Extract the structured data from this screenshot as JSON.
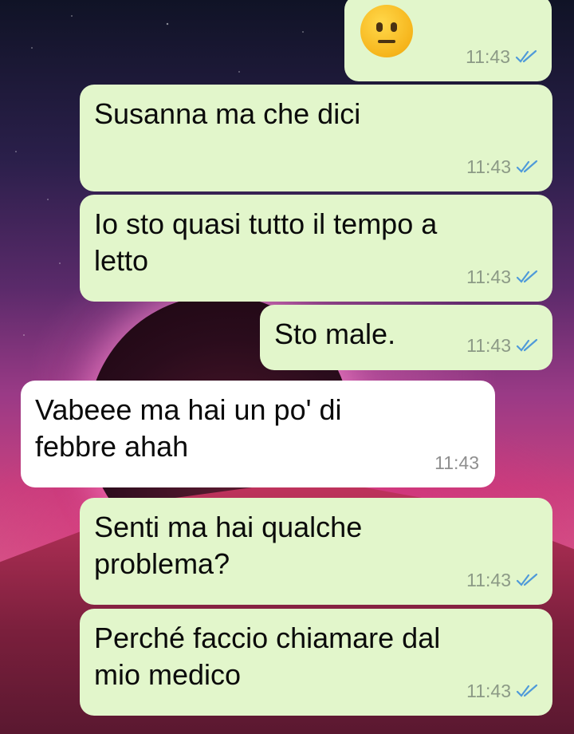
{
  "background": {
    "colors": {
      "out_bubble": "#e2f6cb",
      "in_bubble": "#ffffff",
      "read_tick": "#4f9ad9"
    }
  },
  "messages": [
    {
      "direction": "out",
      "emoji": "neutral-face-icon",
      "text": "",
      "time": "11:43",
      "status": "read"
    },
    {
      "direction": "out",
      "text": "Susanna ma che dici",
      "time": "11:43",
      "status": "read"
    },
    {
      "direction": "out",
      "text": "Io sto quasi tutto il tempo a\nletto",
      "time": "11:43",
      "status": "read"
    },
    {
      "direction": "out",
      "text": "Sto male.",
      "time": "11:43",
      "status": "read"
    },
    {
      "direction": "in",
      "text": "Vabeee ma hai un po' di\nfebbre ahah",
      "time": "11:43"
    },
    {
      "direction": "out",
      "text": "Senti ma hai qualche\nproblema?",
      "time": "11:43",
      "status": "read"
    },
    {
      "direction": "out",
      "text": "Perché faccio chiamare dal\nmio medico",
      "time": "11:43",
      "status": "read"
    }
  ]
}
